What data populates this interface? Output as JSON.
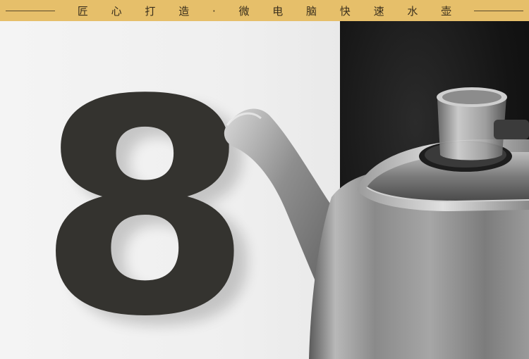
{
  "banner": {
    "title": "匠 心 打 造 · 微 电 脑 快 速 水 壶"
  },
  "hero": {
    "numeral": "8"
  },
  "colors": {
    "banner_bg": "#e6bf6a",
    "numeral": "#34332f",
    "dark_panel": "#141414",
    "steel": "#9a9a9a"
  }
}
